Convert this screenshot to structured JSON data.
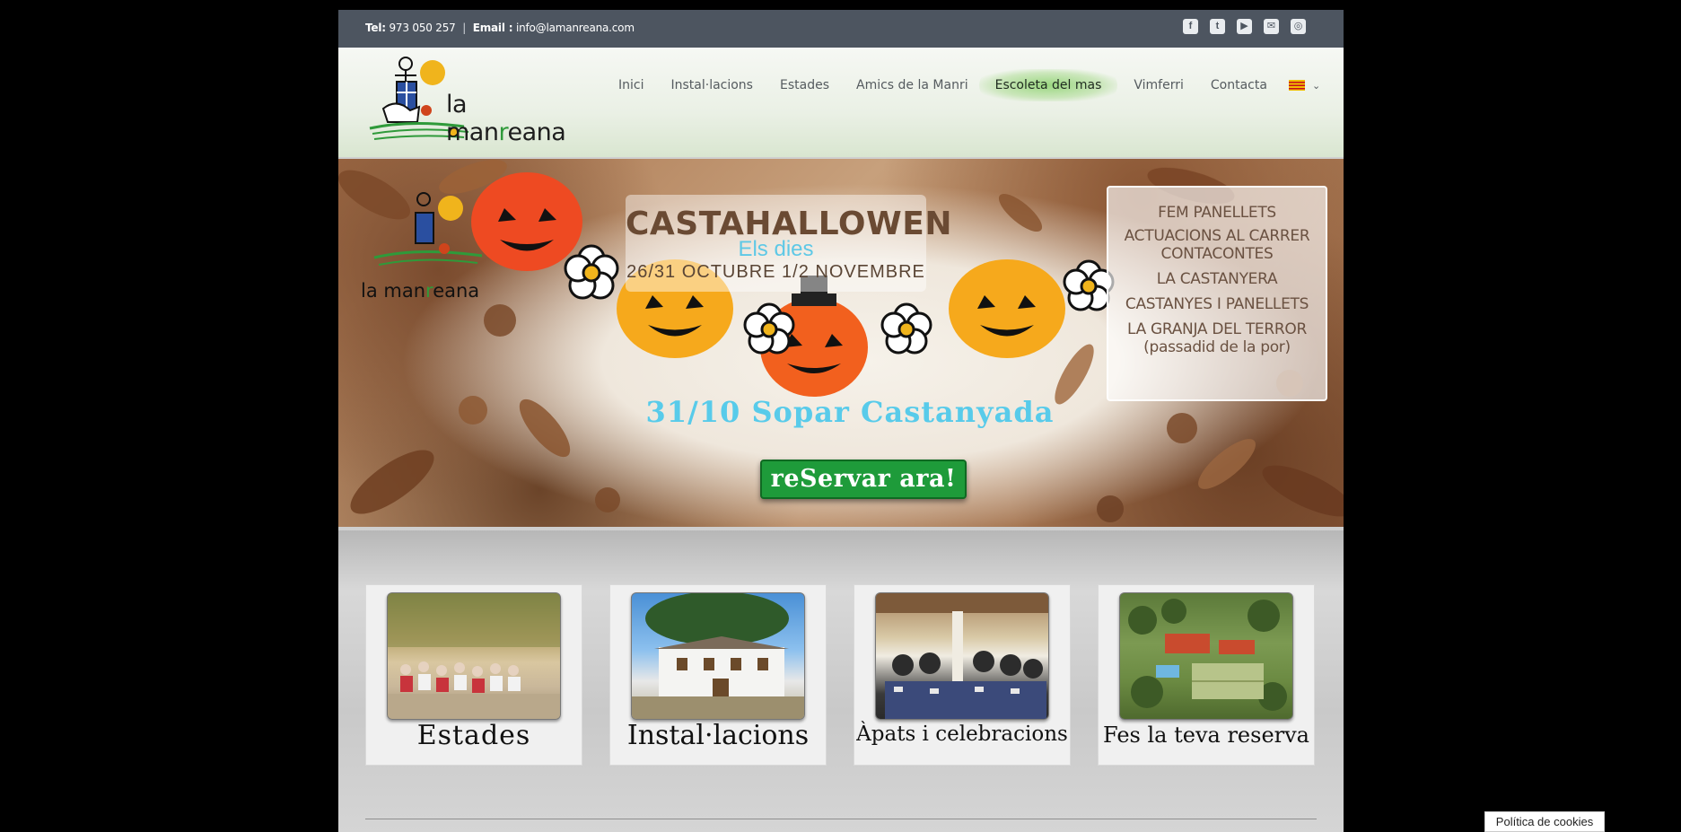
{
  "topbar": {
    "tel_label": "Tel:",
    "tel_value": "973 050 257",
    "separator": "|",
    "email_label": "Email :",
    "email_value": "info@lamanreana.com",
    "social": [
      {
        "icon": "facebook-icon",
        "glyph": "f"
      },
      {
        "icon": "twitter-icon",
        "glyph": "t"
      },
      {
        "icon": "youtube-icon",
        "glyph": "▶"
      },
      {
        "icon": "email-icon",
        "glyph": "✉"
      },
      {
        "icon": "instagram-icon",
        "glyph": "◎"
      }
    ]
  },
  "logo": {
    "brand_prefix": "la man",
    "brand_r": "r",
    "brand_suffix": "eana"
  },
  "nav": {
    "items": [
      "Inici",
      "Instal·lacions",
      "Estades",
      "Amics de la Manri",
      "Escoleta del mas",
      "Vimferri",
      "Contacta"
    ],
    "active_index": 4,
    "chevron": "⌄"
  },
  "hero": {
    "title": "CASTAHALLOWEN",
    "subtitle": "Els dies",
    "dates": "26/31 OCTUBRE 1/2 NOVEMBRE",
    "activities": [
      "FEM PANELLETS",
      "ACTUACIONS AL CARRER",
      "CONTACONTES",
      "LA CASTANYERA",
      "CASTANYES I PANELLETS",
      "LA GRANJA DEL TERROR",
      "(passadid de la por)"
    ],
    "dinner": "31/10 Sopar Castanyada",
    "cta": "reServar ara!",
    "logo_prefix": "la man",
    "logo_r": "r",
    "logo_suffix": "eana"
  },
  "cards": [
    {
      "caption": "Estades"
    },
    {
      "caption": "Instal·lacions"
    },
    {
      "caption": "Àpats i celebracions"
    },
    {
      "caption": "Fes la teva reserva"
    }
  ],
  "cookie": "Política de cookies",
  "colors": {
    "topbar": "#4d5560",
    "accent_green": "#1e9b3a",
    "sky_blue": "#58cbea"
  }
}
